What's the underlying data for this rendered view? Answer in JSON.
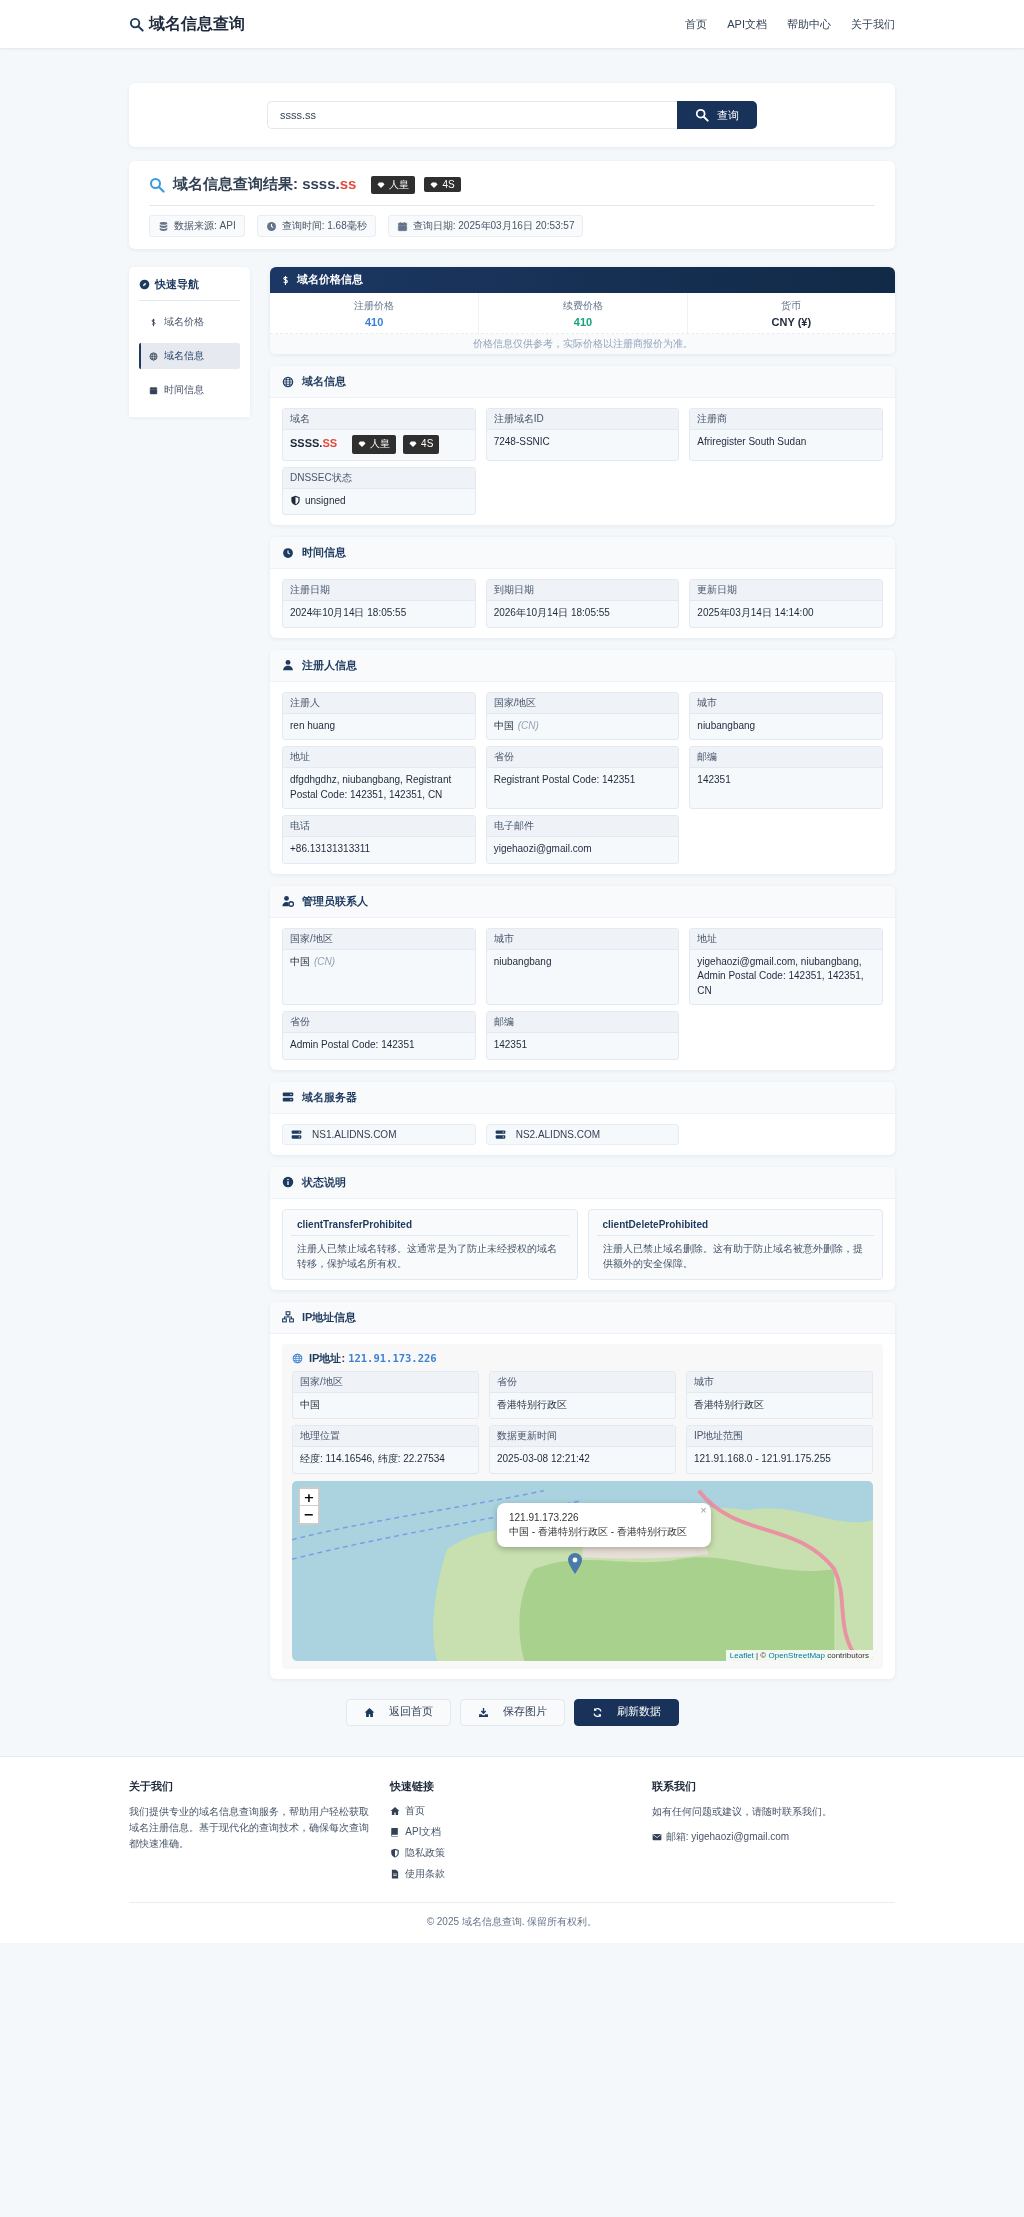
{
  "header": {
    "logo": "域名信息查询",
    "nav": [
      {
        "label": "首页"
      },
      {
        "label": "API文档"
      },
      {
        "label": "帮助中心"
      },
      {
        "label": "关于我们"
      }
    ]
  },
  "search": {
    "value": "ssss.ss",
    "button": "查询"
  },
  "result": {
    "title": "域名信息查询结果: ",
    "domain": "ssss.",
    "tld": "ss",
    "badges": [
      "人皇",
      "4S"
    ],
    "meta": [
      {
        "kind": "source",
        "text": "数据来源: API"
      },
      {
        "kind": "time",
        "text": "查询时间: 1.68毫秒"
      },
      {
        "kind": "date",
        "text": "查询日期: 2025年03月16日 20:53:57"
      }
    ]
  },
  "sidebar": {
    "title": "快速导航",
    "items": [
      {
        "kind": "price",
        "label": "域名价格",
        "selected": false
      },
      {
        "kind": "globe",
        "label": "域名信息",
        "selected": true
      },
      {
        "kind": "calendar",
        "label": "时间信息",
        "selected": false
      }
    ]
  },
  "price": {
    "title": "域名价格信息",
    "items": [
      {
        "label": "注册价格",
        "value": "410",
        "color": "#3b82d6"
      },
      {
        "label": "续费价格",
        "value": "410",
        "color": "#16a37f"
      },
      {
        "label": "货币",
        "value": "CNY (¥)",
        "color": "#1e293b"
      }
    ],
    "note": "价格信息仅供参考，实际价格以注册商报价为准。"
  },
  "sections": [
    {
      "kind": "domain",
      "title": "域名信息",
      "fields": [
        {
          "kind": "domain",
          "label": "域名",
          "value": "SSSS.",
          "tld": "SS",
          "badges": [
            "人皇",
            "4S"
          ]
        },
        {
          "kind": "text",
          "label": "注册域名ID",
          "value": "7248-SSNIC"
        },
        {
          "kind": "text",
          "label": "注册商",
          "value": "Afriregister South Sudan"
        },
        {
          "kind": "dnssec",
          "label": "DNSSEC状态",
          "value": "unsigned"
        }
      ]
    },
    {
      "kind": "time",
      "title": "时间信息",
      "fields": [
        {
          "kind": "text",
          "label": "注册日期",
          "value": "2024年10月14日 18:05:55"
        },
        {
          "kind": "text",
          "label": "到期日期",
          "value": "2026年10月14日 18:05:55"
        },
        {
          "kind": "text",
          "label": "更新日期",
          "value": "2025年03月14日 14:14:00"
        }
      ]
    },
    {
      "kind": "registrant",
      "title": "注册人信息",
      "fields": [
        {
          "kind": "text",
          "label": "注册人",
          "value": "ren huang"
        },
        {
          "kind": "country",
          "label": "国家/地区",
          "value": "中国",
          "code": "(CN)"
        },
        {
          "kind": "text",
          "label": "城市",
          "value": "niubangbang"
        },
        {
          "kind": "text",
          "label": "地址",
          "value": "dfgdhgdhz, niubangbang, Registrant Postal Code: 142351, 142351, CN"
        },
        {
          "kind": "text",
          "label": "省份",
          "value": "Registrant Postal Code: 142351"
        },
        {
          "kind": "text",
          "label": "邮编",
          "value": "142351"
        },
        {
          "kind": "text",
          "label": "电话",
          "value": "+86.13131313311"
        },
        {
          "kind": "text",
          "label": "电子邮件",
          "value": "yigehaozi@gmail.com"
        }
      ]
    },
    {
      "kind": "admin",
      "title": "管理员联系人",
      "fields": [
        {
          "kind": "country",
          "label": "国家/地区",
          "value": "中国",
          "code": "(CN)"
        },
        {
          "kind": "text",
          "label": "城市",
          "value": "niubangbang"
        },
        {
          "kind": "text",
          "label": "地址",
          "value": "yigehaozi@gmail.com, niubangbang, Admin Postal Code: 142351, 142351, CN"
        },
        {
          "kind": "text",
          "label": "省份",
          "value": "Admin Postal Code: 142351"
        },
        {
          "kind": "text",
          "label": "邮编",
          "value": "142351"
        }
      ]
    },
    {
      "kind": "nameservers",
      "title": "域名服务器",
      "servers": [
        "NS1.ALIDNS.COM",
        "NS2.ALIDNS.COM"
      ]
    },
    {
      "kind": "status",
      "title": "状态说明",
      "statuses": [
        {
          "code": "clientTransferProhibited",
          "text": "注册人已禁止域名转移。这通常是为了防止未经授权的域名转移，保护域名所有权。"
        },
        {
          "code": "clientDeleteProhibited",
          "text": "注册人已禁止域名删除。这有助于防止域名被意外删除，提供额外的安全保障。"
        }
      ]
    },
    {
      "kind": "ip",
      "title": "IP地址信息",
      "ip_label": "IP地址: ",
      "ip": "121.91.173.226",
      "fields": [
        {
          "kind": "text",
          "label": "国家/地区",
          "value": "中国"
        },
        {
          "kind": "text",
          "label": "省份",
          "value": "香港特别行政区"
        },
        {
          "kind": "text",
          "label": "城市",
          "value": "香港特别行政区"
        },
        {
          "kind": "text",
          "label": "地理位置",
          "value": "经度: 114.16546, 纬度: 22.27534"
        },
        {
          "kind": "text",
          "label": "数据更新时间",
          "value": "2025-03-08 12:21:42"
        },
        {
          "kind": "text",
          "label": "IP地址范围",
          "value": "121.91.168.0 - 121.91.175.255"
        }
      ],
      "map": {
        "zoom_in": "+",
        "zoom_out": "−",
        "popup": {
          "close": "×",
          "lines": [
            "121.91.173.226",
            "中国 - 香港特别行政区 - 香港特别行政区"
          ]
        },
        "attribution": [
          {
            "kind": "link",
            "text": "Leaflet"
          },
          {
            "kind": "text",
            "text": " | © "
          },
          {
            "kind": "link",
            "text": "OpenStreetMap"
          },
          {
            "kind": "text",
            "text": " contributors"
          }
        ]
      }
    }
  ],
  "actions": [
    {
      "kind": "home",
      "label": "返回首页",
      "primary": false
    },
    {
      "kind": "download",
      "label": "保存图片",
      "primary": false
    },
    {
      "kind": "refresh",
      "label": "刷新数据",
      "primary": true
    }
  ],
  "footer": {
    "about": {
      "title": "关于我们",
      "text": "我们提供专业的域名信息查询服务，帮助用户轻松获取域名注册信息。基于现代化的查询技术，确保每次查询都快速准确。"
    },
    "links": {
      "title": "快速链接",
      "items": [
        {
          "kind": "home",
          "label": "首页"
        },
        {
          "kind": "book",
          "label": "API文档"
        },
        {
          "kind": "shield",
          "label": "隐私政策"
        },
        {
          "kind": "file",
          "label": "使用条款"
        }
      ]
    },
    "contact": {
      "title": "联系我们",
      "text": "如有任何问题或建议，请随时联系我们。",
      "email": "邮箱: yigehaozi@gmail.com"
    },
    "copyright": "© 2025 域名信息查询. 保留所有权利。"
  }
}
